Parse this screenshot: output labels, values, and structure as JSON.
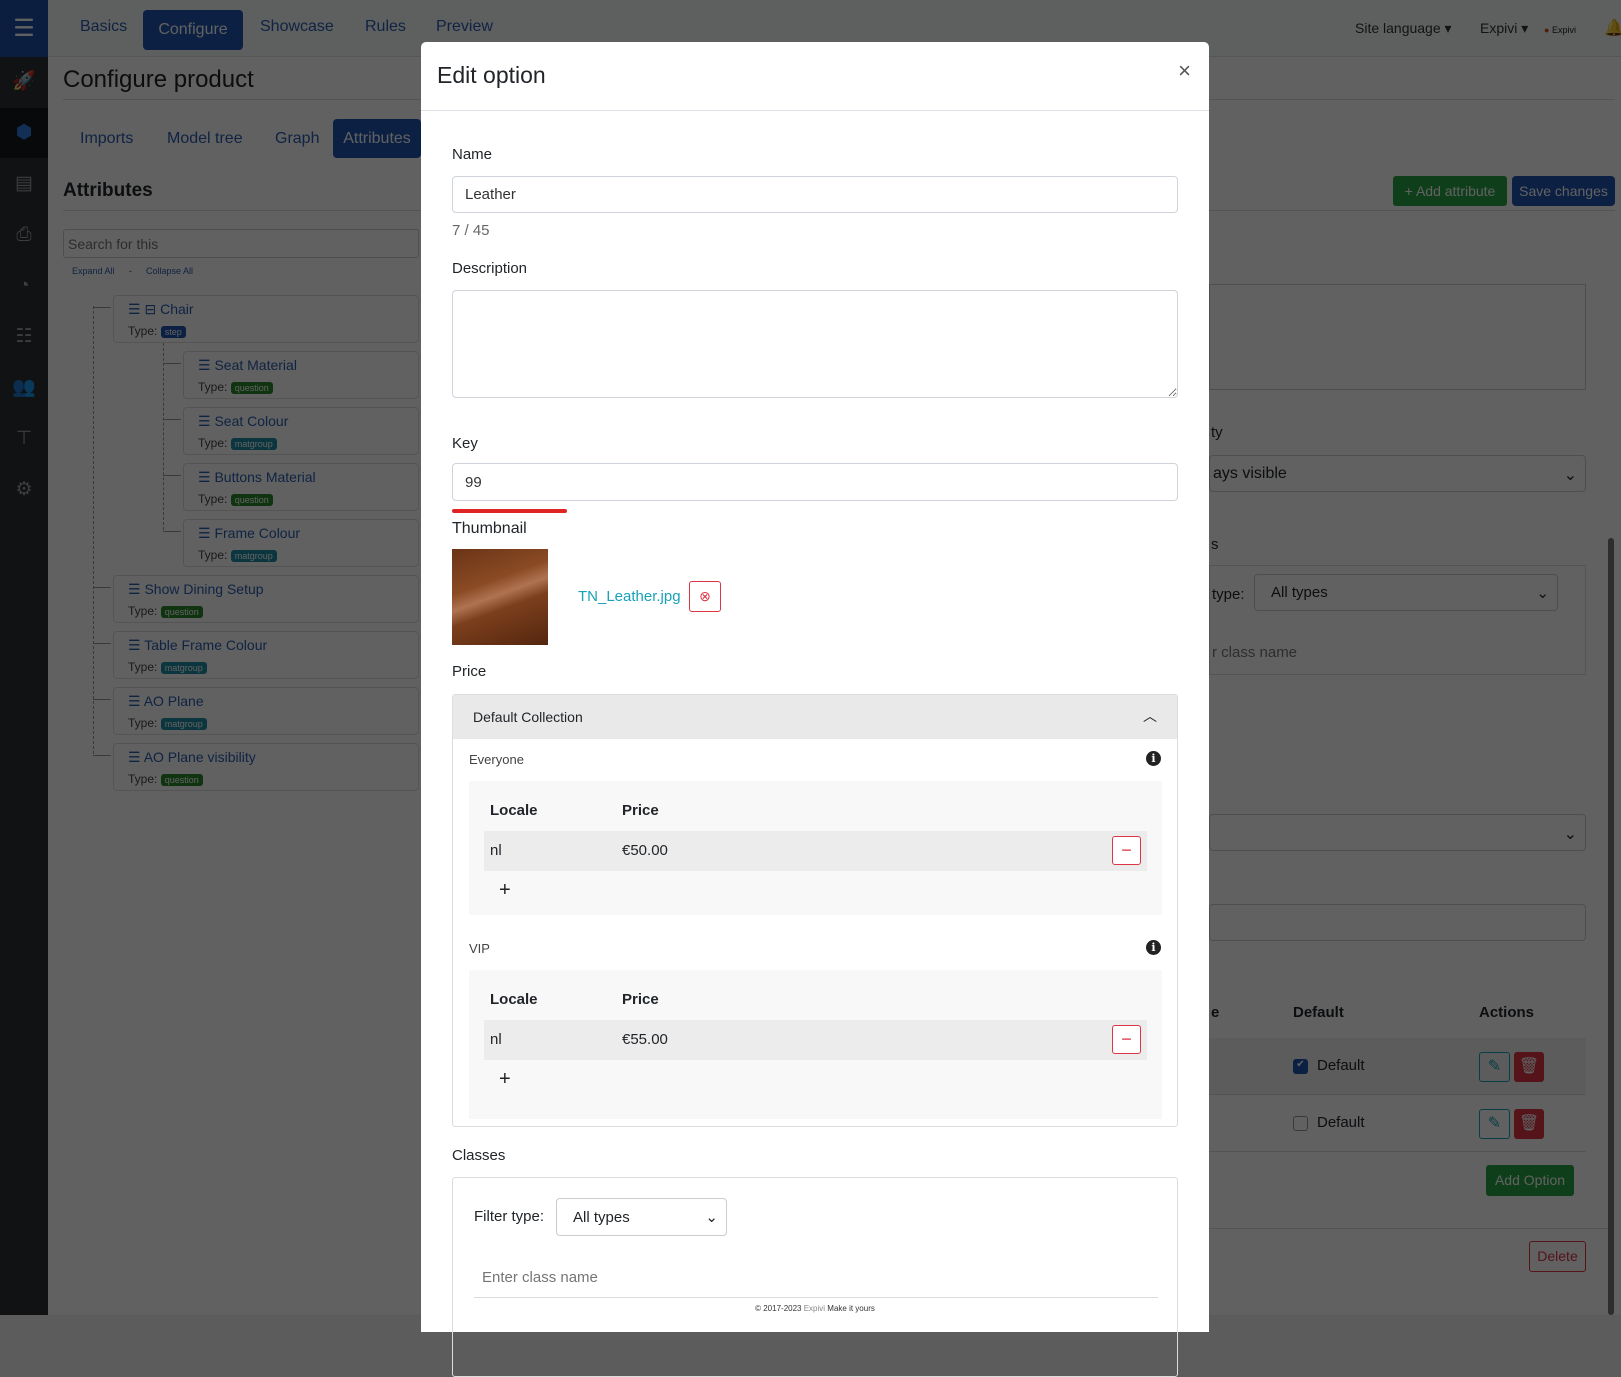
{
  "sidebar": {
    "icons": [
      "menu-icon",
      "rocket-icon",
      "cube-icon",
      "list-icon",
      "print-icon",
      "pie-chart-icon",
      "checklist-icon",
      "users-icon",
      "sitemap-icon",
      "settings-icon"
    ]
  },
  "topnav": {
    "tabs": [
      "Basics",
      "Configure",
      "Showcase",
      "Rules",
      "Preview"
    ],
    "active": "Configure",
    "site_language": "Site language",
    "user": "Expivi",
    "logo_text": "Expivi"
  },
  "page": {
    "title": "Configure product",
    "subtabs": [
      "Imports",
      "Model tree",
      "Graph",
      "Attributes"
    ],
    "active_subtab": "Attributes",
    "section_title": "Attributes",
    "search_placeholder": "Search for this",
    "expand_all": "Expand All",
    "separator": "-",
    "collapse_all": "Collapse All",
    "add_attribute": "Add attribute",
    "save_changes": "Save changes"
  },
  "tree": {
    "type_label": "Type:",
    "items": [
      {
        "name": "Chair",
        "type": "step"
      },
      {
        "name": "Seat Material",
        "type": "question"
      },
      {
        "name": "Seat Colour",
        "type": "matgroup"
      },
      {
        "name": "Buttons Material",
        "type": "question"
      },
      {
        "name": "Frame Colour",
        "type": "matgroup"
      },
      {
        "name": "Show Dining Setup",
        "type": "question"
      },
      {
        "name": "Table Frame Colour",
        "type": "matgroup"
      },
      {
        "name": "AO Plane",
        "type": "matgroup"
      },
      {
        "name": "AO Plane visibility",
        "type": "question"
      }
    ]
  },
  "right_panel": {
    "visibility_label_fragment": "ty",
    "visibility_value_fragment": "ays visible",
    "classes_label_fragment": "s",
    "filter_type_fragment": "type:",
    "filter_type_value": "All types",
    "class_name_fragment": "r class name",
    "col_fragment": "e",
    "col_default": "Default",
    "col_actions": "Actions",
    "options": [
      {
        "default_label": "Default",
        "checked": true
      },
      {
        "default_label": "Default",
        "checked": false
      }
    ],
    "add_option": "Add Option",
    "delete": "Delete"
  },
  "modal": {
    "title": "Edit option",
    "close": "×",
    "name_label": "Name",
    "name_value": "Leather",
    "name_counter": "7 / 45",
    "description_label": "Description",
    "description_value": "",
    "key_label": "Key",
    "key_value": "99",
    "thumbnail_label": "Thumbnail",
    "thumbnail_file": "TN_Leather.jpg",
    "price_label": "Price",
    "collection": "Default Collection",
    "price_groups": [
      {
        "name": "Everyone",
        "col_locale": "Locale",
        "col_price": "Price",
        "rows": [
          {
            "locale": "nl",
            "price": "€50.00"
          }
        ]
      },
      {
        "name": "VIP",
        "col_locale": "Locale",
        "col_price": "Price",
        "rows": [
          {
            "locale": "nl",
            "price": "€55.00"
          }
        ]
      }
    ],
    "classes_label": "Classes",
    "filter_type_label": "Filter type:",
    "filter_type_value": "All types",
    "class_name_placeholder": "Enter class name"
  },
  "footer": {
    "copyright": "© 2017-2023",
    "brand": "Expivi",
    "tagline": "Make it yours"
  },
  "colors": {
    "primary": "#2055b3",
    "success": "#28a745",
    "danger": "#dc3545",
    "info": "#17a2b8",
    "key_underline": "#e02424"
  }
}
